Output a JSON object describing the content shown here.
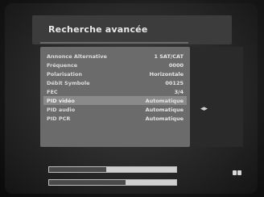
{
  "menu": {
    "title": "Recherche avancée",
    "rows": [
      {
        "label": "Annonce Alternative",
        "value": "1 SAT/CAT"
      },
      {
        "label": "Fréquence",
        "value": "0000"
      },
      {
        "label": "Polarisation",
        "value": "Horizontale"
      },
      {
        "label": "Débit Symbole",
        "value": "00125"
      },
      {
        "label": "FEC",
        "value": "3/4"
      },
      {
        "label": "PID vidéo",
        "value": "Automatique"
      },
      {
        "label": "PID audio",
        "value": "Automatique"
      },
      {
        "label": "PID PCR",
        "value": "Automatique"
      }
    ],
    "selected_index": 5
  },
  "signal": {
    "bar1_fraction": 0.45,
    "bar2_fraction": 0.6
  },
  "icons": {
    "selector": "left-right-arrow-icon",
    "ok": "ok-button-icon"
  }
}
